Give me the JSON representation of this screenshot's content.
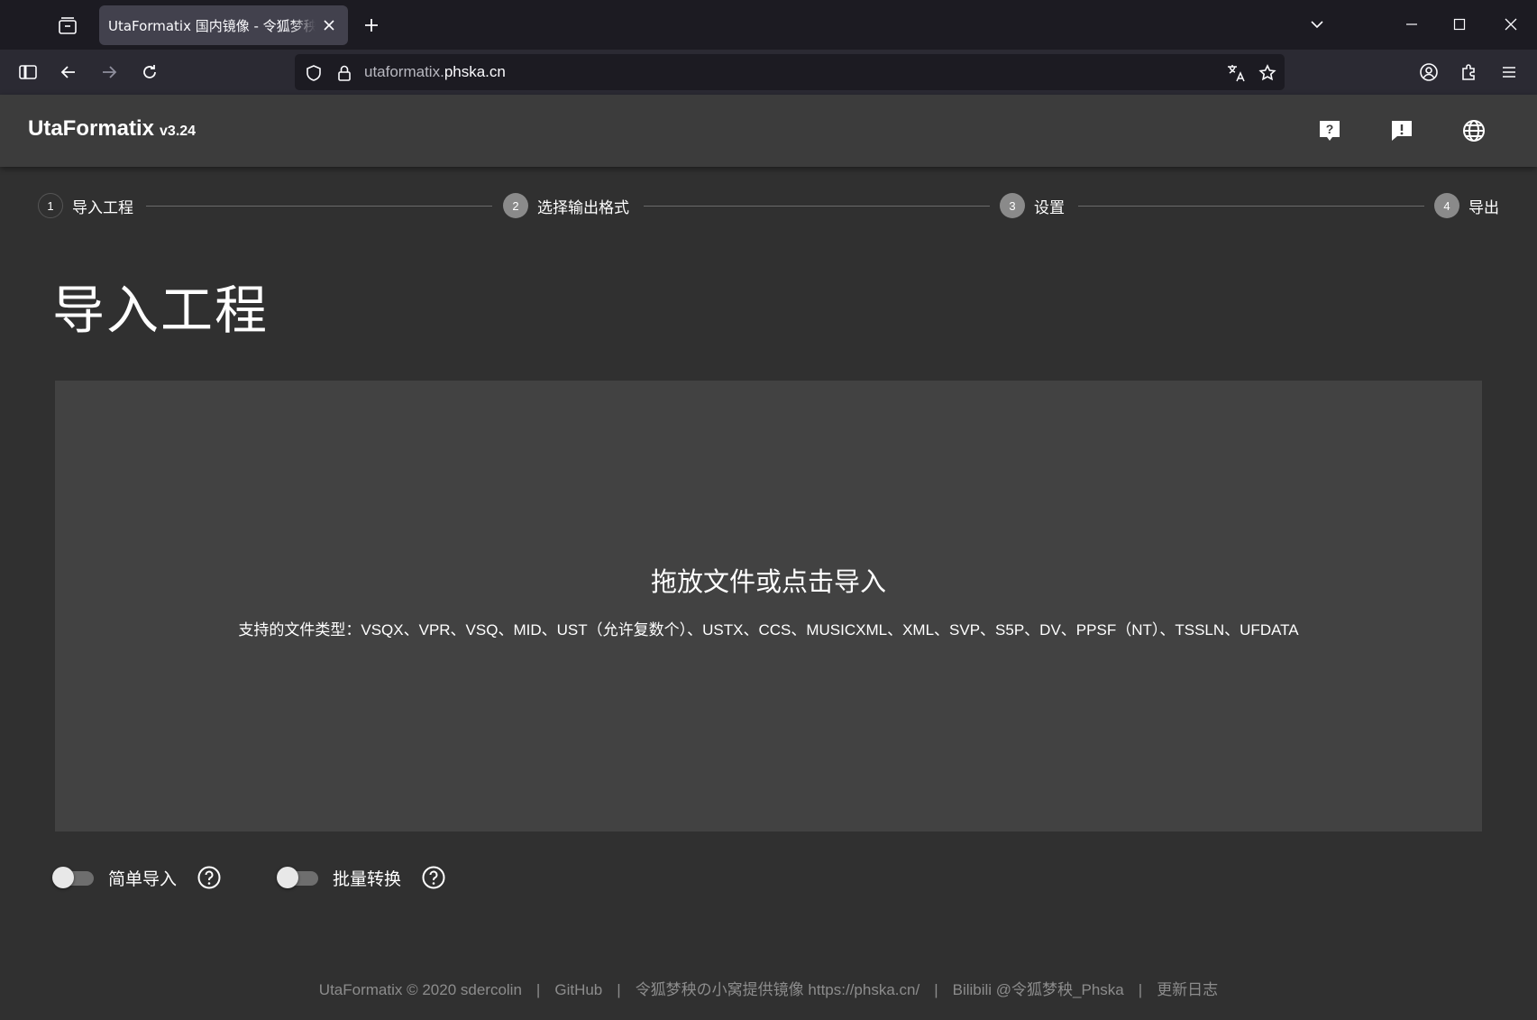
{
  "browser": {
    "tab_title": "UtaFormatix 国内镜像 - 令狐梦秧の小窝",
    "url_host_prefix": "utaformatix.",
    "url_host_domain": "phska.cn"
  },
  "app": {
    "name": "UtaFormatix",
    "version": "v3.24"
  },
  "stepper": [
    {
      "num": "1",
      "label": "导入工程"
    },
    {
      "num": "2",
      "label": "选择输出格式"
    },
    {
      "num": "3",
      "label": "设置"
    },
    {
      "num": "4",
      "label": "导出"
    }
  ],
  "page_title": "导入工程",
  "dropzone": {
    "title": "拖放文件或点击导入",
    "subtitle": "支持的文件类型：VSQX、VPR、VSQ、MID、UST（允许复数个）、USTX、CCS、MUSICXML、XML、SVP、S5P、DV、PPSF（NT）、TSSLN、UFDATA"
  },
  "options": {
    "simple_import": "简单导入",
    "batch_convert": "批量转换"
  },
  "footer": {
    "copyright": "UtaFormatix © 2020 sdercolin",
    "github": "GitHub",
    "mirror": "令狐梦秧の小窝提供镜像 https://phska.cn/",
    "bilibili": "Bilibili @令狐梦秧_Phska",
    "changelog": "更新日志",
    "separator": "|"
  }
}
